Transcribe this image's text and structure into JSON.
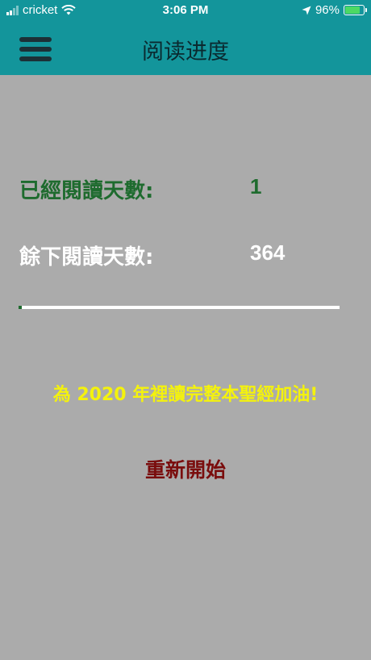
{
  "status_bar": {
    "carrier": "cricket",
    "time": "3:06 PM",
    "battery_text": "96%",
    "battery_level": 0.96,
    "signal_bars": 4,
    "signal_bars_active": 2
  },
  "nav": {
    "title": "阅读进度",
    "menu_icon": "hamburger-menu-icon"
  },
  "stats": {
    "days_read_label": "已經閱讀天數:",
    "days_read_value": "1",
    "days_left_label": "餘下閱讀天數:",
    "days_left_value": "364"
  },
  "progress": {
    "fraction": 0.0027
  },
  "cheer_text": "為 2020 年裡讀完整本聖經加油!",
  "restart_label": "重新開始",
  "colors": {
    "bar_bg": "#13959b",
    "page_bg": "#ababab",
    "days_read": "#1e6b2e",
    "days_left": "#ffffff",
    "cheer": "#f4f20d",
    "restart": "#7a0d0d"
  }
}
